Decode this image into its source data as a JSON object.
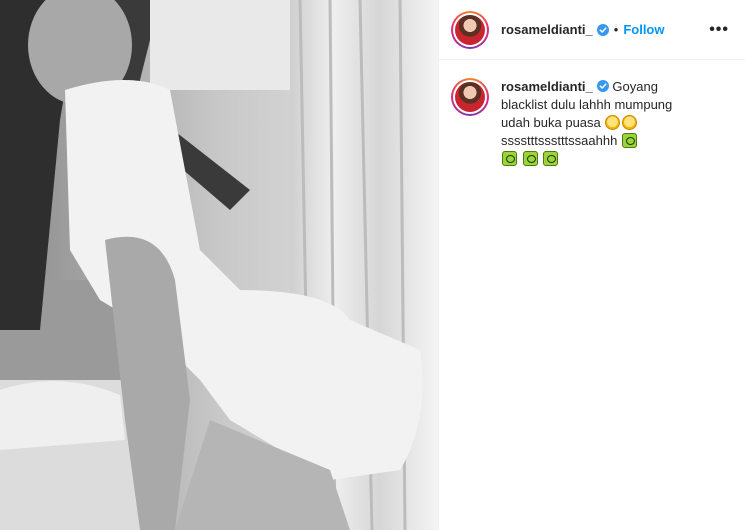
{
  "post": {
    "username": "rosameldianti_",
    "dot": "•",
    "follow_label": "Follow",
    "more_label": "•••"
  },
  "caption": {
    "username": "rosameldianti_",
    "text_1": "Goyang blacklist dulu lahhh mumpung udah buka puasa",
    "text_2": "sssstttssstttssaahhh",
    "emojis": [
      "smiling-face-icon",
      "grinning-face-icon",
      "loop-icon",
      "loop-icon",
      "loop-icon",
      "loop-icon"
    ]
  },
  "colors": {
    "follow_blue": "#0095f6",
    "verified_blue": "#3897f0",
    "text": "#262626",
    "border": "#efefef"
  }
}
